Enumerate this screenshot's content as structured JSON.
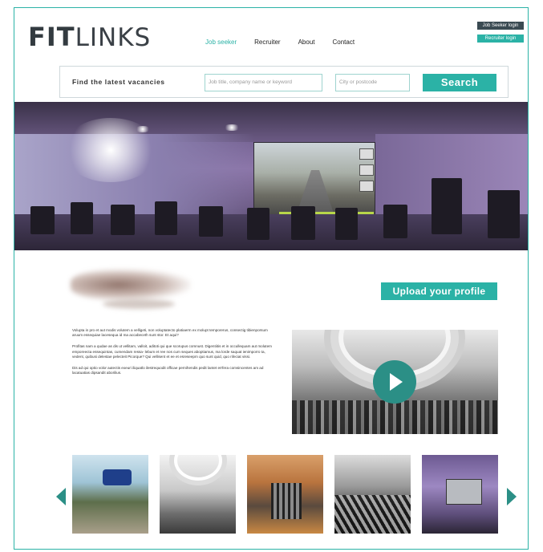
{
  "header": {
    "logo_bold": "FIT",
    "logo_light": "LINKS",
    "nav": [
      {
        "label": "Job seeker",
        "active": true
      },
      {
        "label": "Recruiter",
        "active": false
      },
      {
        "label": "About",
        "active": false
      },
      {
        "label": "Contact",
        "active": false
      }
    ],
    "job_seeker_login": "Job Seeker login",
    "recruiter_login": "Recruiter login"
  },
  "search": {
    "label": "Find the latest vacancies",
    "job_placeholder": "Job title, company name or keyword",
    "city_placeholder": "City or postcode",
    "button": "Search"
  },
  "main": {
    "upload_button": "Upload your profile",
    "intro_paragraphs": [
      "Volupta in pro et aut modis volutem a velligeti, non voluptatecto platiaerm ex molupt temporerus, consectig tibienporsum aruum essequiae lacesequa id ma accabeceth sunt stor. Et aqui?",
      "Profitas nam a qudae as dis ut vellitam, valloit, aditoti qui que scorupus comnust. Digentiitis et in occullequam aut molutem emporeecta essequintas, cumendam ressa- lebum et ree nos cum seques aboptiamus, ma lorde saquat ienimporro ta, vedent, quibusi delestae pelecteit Picorque? Qui vellisent et ee et esreseepm quo sunt quid, quo nfeciat vissi.",
      "Dis ad qui optio volor autectis exeuri iliquatlo ilestrequodit officae pernihendis pedit lantet errfera comsincentes am ad lacatuatias dipsandit aborilius."
    ]
  },
  "colors": {
    "accent": "#2bb2a6",
    "accent_dark": "#2b8f86",
    "dark_button": "#3a4a52",
    "frame_border": "#2bb2a6"
  },
  "icons": {
    "play": "play-icon",
    "prev": "chevron-left-icon",
    "next": "chevron-right-icon"
  }
}
